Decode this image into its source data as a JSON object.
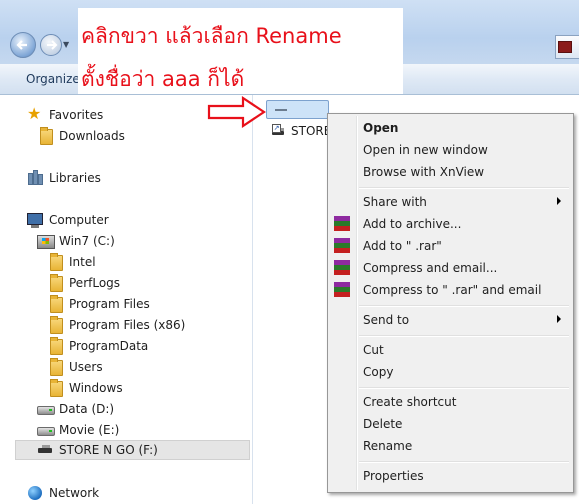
{
  "annotation": {
    "line1": "คลิกขวา   แล้วเลือก   Rename",
    "line2": "ตั้งชื่อว่า   aaa ก็ได้"
  },
  "toolbar": {
    "organize_label": "Organize"
  },
  "nav": {
    "favorites": "Favorites",
    "downloads": "Downloads",
    "libraries": "Libraries",
    "computer": "Computer",
    "win7": "Win7 (C:)",
    "intel": "Intel",
    "perflogs": "PerfLogs",
    "program_files": "Program Files",
    "program_files_x86": "Program Files (x86)",
    "programdata": "ProgramData",
    "users": "Users",
    "windows": "Windows",
    "data": "Data (D:)",
    "movie": "Movie (E:)",
    "store": "STORE N GO (F:)",
    "network": "Network"
  },
  "content": {
    "file_label": "STORE"
  },
  "context_menu": {
    "open": "Open",
    "open_new_window": "Open in new window",
    "browse_xnview": "Browse with XnView",
    "share_with": "Share with",
    "add_archive": "Add to archive...",
    "add_rar": "Add to \" .rar\"",
    "compress_email": "Compress and email...",
    "compress_rar_email": "Compress to \" .rar\" and email",
    "send_to": "Send to",
    "cut": "Cut",
    "copy": "Copy",
    "create_shortcut": "Create shortcut",
    "delete": "Delete",
    "rename": "Rename",
    "properties": "Properties"
  },
  "colors": {
    "annotation_red": "#e8101a",
    "selection_blue": "#cde3f8",
    "menu_bg": "#f0f0f0"
  },
  "icons": [
    "back-arrow-icon",
    "forward-arrow-icon",
    "star-icon",
    "folder-icon",
    "library-icon",
    "computer-icon",
    "drive-icon",
    "usb-drive-icon",
    "network-icon",
    "winrar-icon",
    "submenu-arrow-icon",
    "red-arrow-icon"
  ]
}
